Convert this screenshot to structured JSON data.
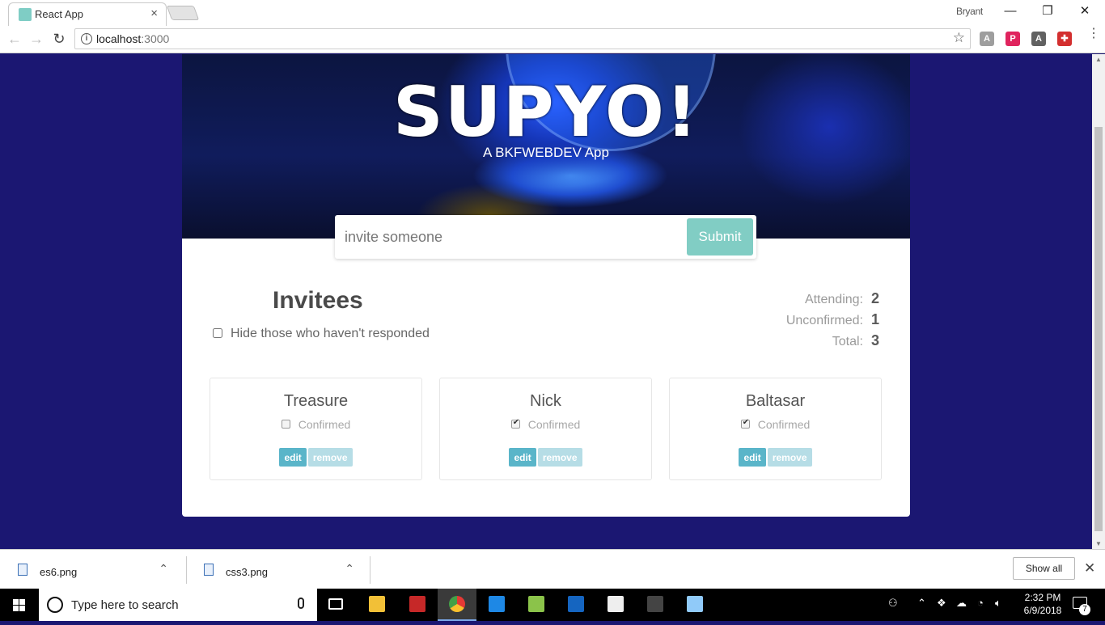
{
  "browser": {
    "tab_title": "React App",
    "tab_close": "×",
    "profile_name": "Bryant",
    "window_controls": {
      "minimize": "—",
      "restore": "❐",
      "close": "✕"
    },
    "nav": {
      "back": "←",
      "forward": "→",
      "reload": "↻"
    },
    "url_host": "localhost",
    "url_port": ":3000",
    "info_glyph": "i",
    "star_glyph": "☆",
    "extensions": [
      {
        "name": "angular-icon",
        "glyph": "A",
        "color": "#9e9e9e"
      },
      {
        "name": "pinterest-icon",
        "glyph": "P",
        "color": "#e0245e"
      },
      {
        "name": "angular-dark-icon",
        "glyph": "A",
        "color": "#616161"
      },
      {
        "name": "extension-red-icon",
        "glyph": "✚",
        "color": "#d32f2f"
      }
    ],
    "menu_glyph": "⋮"
  },
  "app": {
    "logo": "SUPYO!",
    "tagline": "A BKFWEBDEV App",
    "invite_placeholder": "invite someone",
    "submit_label": "Submit",
    "invitees_title": "Invitees",
    "filter_label": "Hide those who haven't responded",
    "filter_checked": false,
    "counts": [
      {
        "label": "Attending:",
        "value": "2"
      },
      {
        "label": "Unconfirmed:",
        "value": "1"
      },
      {
        "label": "Total:",
        "value": "3"
      }
    ],
    "guests": [
      {
        "name": "Treasure",
        "confirmed_label": "Confirmed",
        "confirmed": false,
        "edit_label": "edit",
        "remove_label": "remove"
      },
      {
        "name": "Nick",
        "confirmed_label": "Confirmed",
        "confirmed": true,
        "edit_label": "edit",
        "remove_label": "remove"
      },
      {
        "name": "Baltasar",
        "confirmed_label": "Confirmed",
        "confirmed": true,
        "edit_label": "edit",
        "remove_label": "remove"
      }
    ]
  },
  "downloads": {
    "items": [
      {
        "name": "es6.png",
        "chevron": "⌃"
      },
      {
        "name": "css3.png",
        "chevron": "⌃"
      }
    ],
    "show_all_label": "Show all",
    "close_glyph": "✕"
  },
  "taskbar": {
    "search_placeholder": "Type here to search",
    "apps": [
      {
        "name": "task-view-icon",
        "color": "#000000"
      },
      {
        "name": "file-explorer-icon",
        "color": "#f2c037"
      },
      {
        "name": "filezilla-icon",
        "color": "#c62828"
      },
      {
        "name": "chrome-icon",
        "color": "#4caf50"
      },
      {
        "name": "vscode-icon",
        "color": "#1e88e5"
      },
      {
        "name": "git-icon",
        "color": "#8bc34a"
      },
      {
        "name": "visual-studio-icon",
        "color": "#1565c0"
      },
      {
        "name": "game-icon",
        "color": "#eeeeee"
      },
      {
        "name": "terminal-icon",
        "color": "#444444"
      },
      {
        "name": "paint-icon",
        "color": "#90caf9"
      }
    ],
    "time": "2:32 PM",
    "date": "6/9/2018",
    "notification_count": "7"
  }
}
